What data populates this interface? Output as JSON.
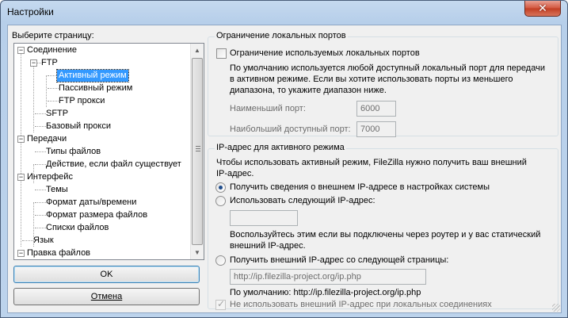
{
  "window": {
    "title": "Настройки",
    "close_glyph": "✕"
  },
  "left": {
    "label": "Выберите страницу:",
    "tree": [
      {
        "label": "Соединение",
        "level": 0,
        "expander": "−"
      },
      {
        "label": "FTP",
        "level": 1,
        "expander": "−"
      },
      {
        "label": "Активный режим",
        "level": 2,
        "selected": true
      },
      {
        "label": "Пассивный режим",
        "level": 2
      },
      {
        "label": "FTP прокси",
        "level": 2
      },
      {
        "label": "SFTP",
        "level": 1
      },
      {
        "label": "Базовый прокси",
        "level": 1
      },
      {
        "label": "Передачи",
        "level": 0,
        "expander": "−"
      },
      {
        "label": "Типы файлов",
        "level": 1
      },
      {
        "label": "Действие, если файл существует",
        "level": 1
      },
      {
        "label": "Интерфейс",
        "level": 0,
        "expander": "−"
      },
      {
        "label": "Темы",
        "level": 1
      },
      {
        "label": "Формат даты/времени",
        "level": 1
      },
      {
        "label": "Формат размера файлов",
        "level": 1
      },
      {
        "label": "Списки файлов",
        "level": 1
      },
      {
        "label": "Язык",
        "level": 0
      },
      {
        "label": "Правка файлов",
        "level": 0,
        "expander": "−"
      }
    ],
    "ok_label": "OK",
    "cancel_label": "Отмена"
  },
  "ports": {
    "title": "Ограничение локальных портов",
    "checkbox_label": "Ограничение используемых локальных портов",
    "desc_1": "По умолчанию используется любой доступный локальный порт для передачи",
    "desc_2": "в активном режиме. Если вы хотите использовать порты из меньшего",
    "desc_3": "диапазона, то укажите диапазон ниже.",
    "min_label": "Наименьший порт:",
    "min_value": "6000",
    "max_label": "Наибольший доступный порт:",
    "max_value": "7000"
  },
  "ip": {
    "title": "IP-адрес для активного режима",
    "desc_1": "Чтобы использовать активный режим, FileZilla нужно получить ваш внешний",
    "desc_2": "IP-адрес.",
    "radio_system": "Получить сведения о внешнем IP-адресе в настройках системы",
    "radio_manual": "Использовать следующий IP-адрес:",
    "manual_value": "",
    "manual_hint_1": "Воспользуйтесь этим если вы подключены через роутер и у вас статический",
    "manual_hint_2": "внешний IP-адрес.",
    "radio_url": "Получить внешний IP-адрес со следующей страницы:",
    "url_value": "http://ip.filezilla-project.org/ip.php",
    "default_text": "По умолчанию: http://ip.filezilla-project.org/ip.php",
    "no_local_label": "Не использовать внешний IP-адрес при локальных соединениях"
  }
}
